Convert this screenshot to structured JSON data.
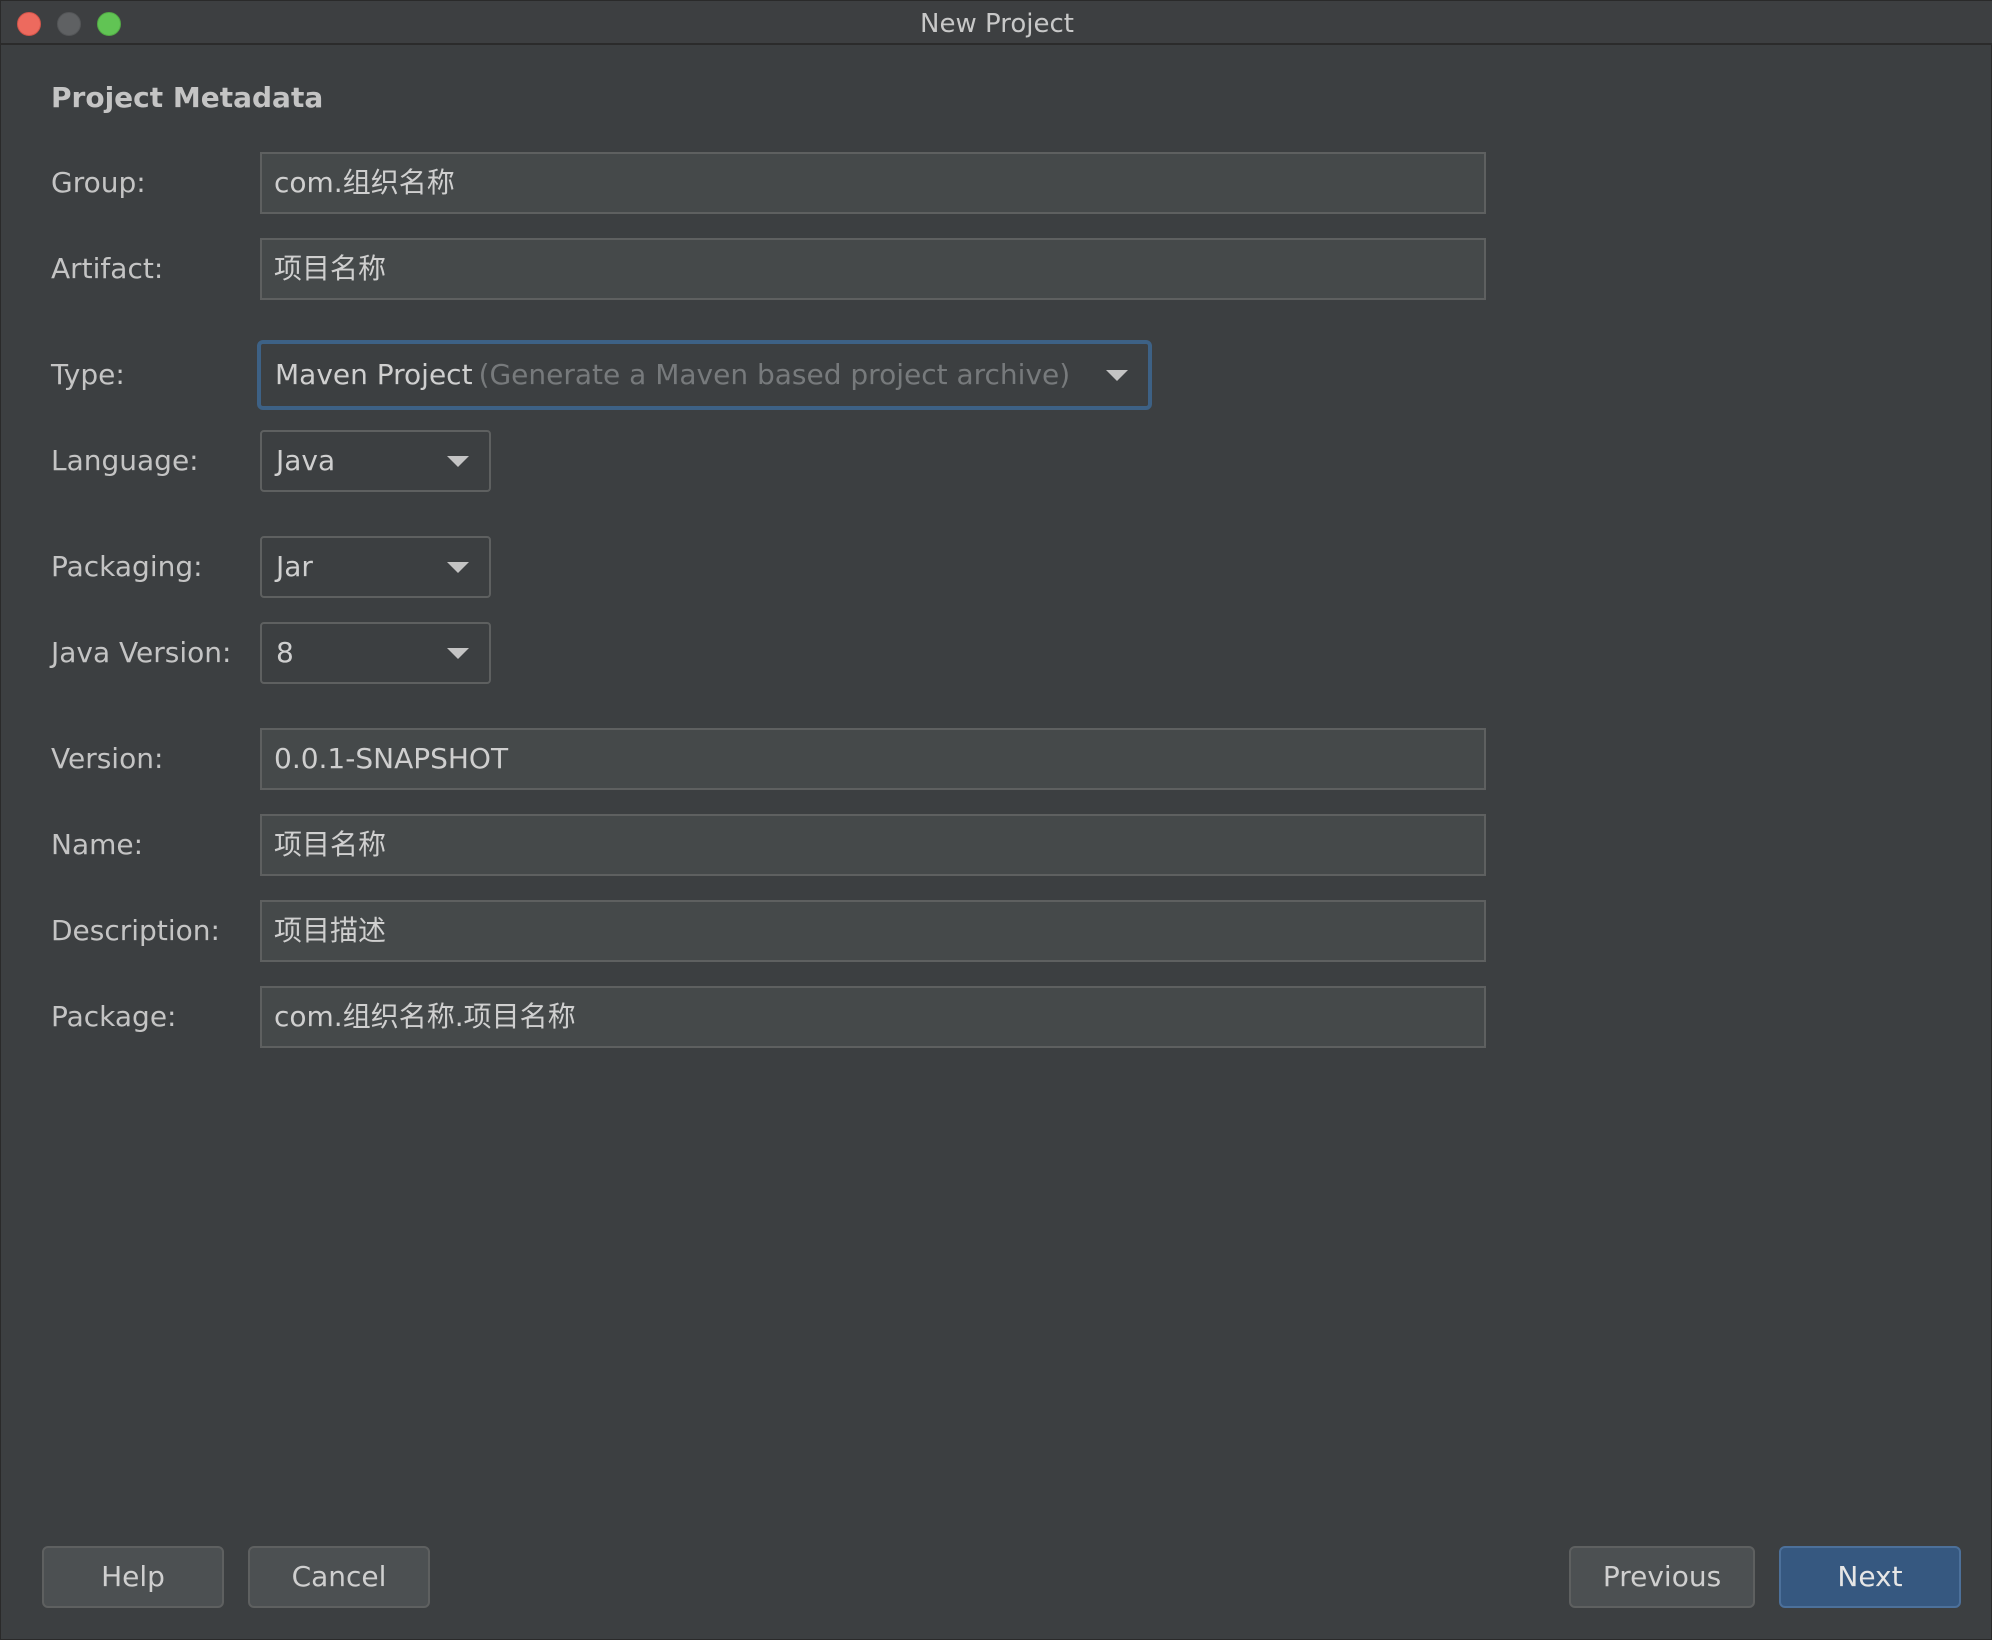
{
  "window": {
    "title": "New Project"
  },
  "section": {
    "title": "Project Metadata"
  },
  "fields": {
    "group": {
      "label": "Group:",
      "value": "com.组织名称"
    },
    "artifact": {
      "label": "Artifact:",
      "value": "项目名称"
    },
    "type": {
      "label": "Type:",
      "value": "Maven Project",
      "hint": "(Generate a Maven based project archive)"
    },
    "language": {
      "label": "Language:",
      "value": "Java"
    },
    "packaging": {
      "label": "Packaging:",
      "value": "Jar"
    },
    "java_version": {
      "label": "Java Version:",
      "value": "8"
    },
    "version": {
      "label": "Version:",
      "value": "0.0.1-SNAPSHOT"
    },
    "name": {
      "label": "Name:",
      "value": "项目名称"
    },
    "description": {
      "label": "Description:",
      "value": "项目描述"
    },
    "package": {
      "label": "Package:",
      "value": "com.组织名称.项目名称"
    }
  },
  "buttons": {
    "help": "Help",
    "cancel": "Cancel",
    "previous": "Previous",
    "next": "Next"
  },
  "colors": {
    "background": "#3c3f41",
    "focus_border": "#3d6185",
    "primary_button": "#365880"
  }
}
